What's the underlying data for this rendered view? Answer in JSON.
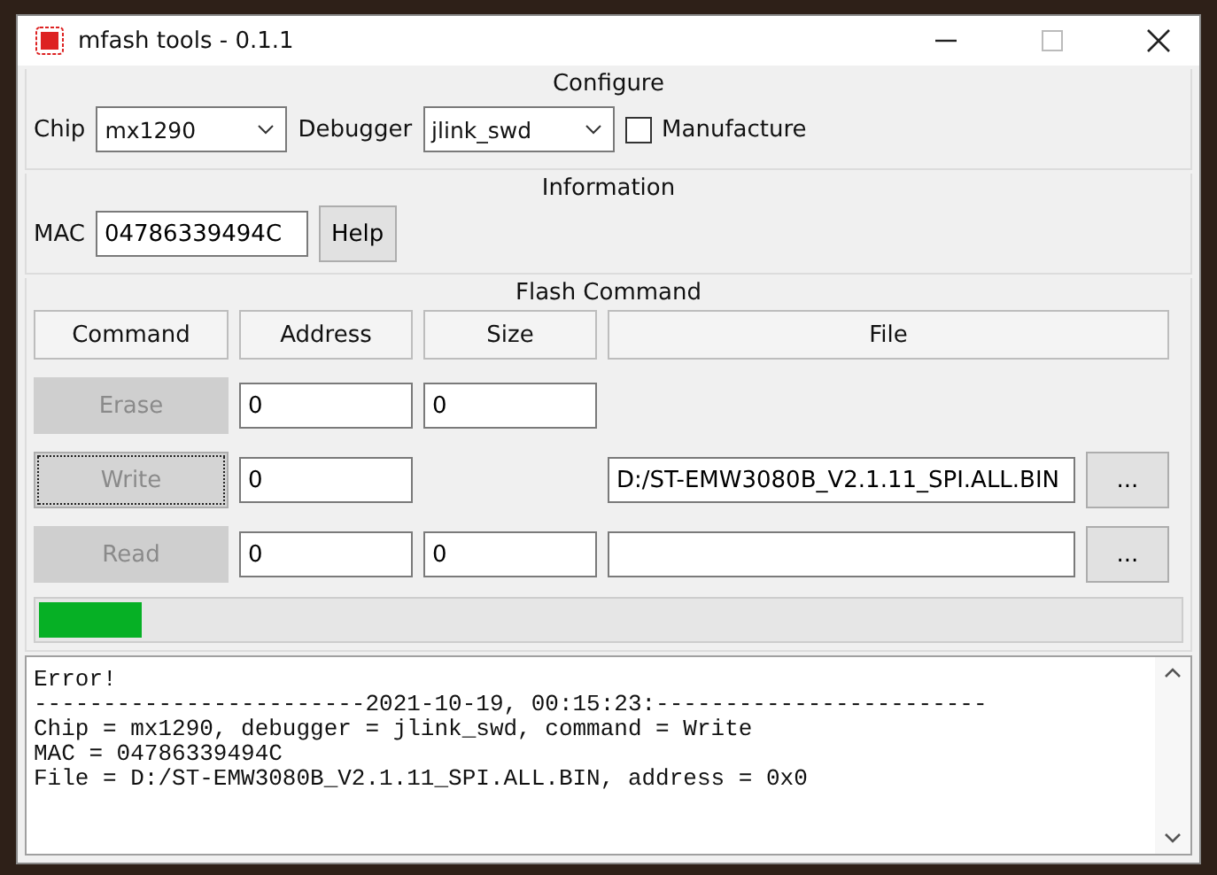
{
  "window": {
    "title": "mfash tools - 0.1.1"
  },
  "configure": {
    "title": "Configure",
    "chip_label": "Chip",
    "chip_value": "mx1290",
    "debugger_label": "Debugger",
    "debugger_value": "jlink_swd",
    "manufacture": {
      "label": "Manufacture",
      "checked": false
    }
  },
  "information": {
    "title": "Information",
    "mac_label": "MAC",
    "mac_value": "04786339494C",
    "help_button": "Help"
  },
  "flash_command": {
    "title": "Flash Command",
    "columns": [
      "Command",
      "Address",
      "Size",
      "File"
    ],
    "rows": [
      {
        "command": "Erase",
        "focused": false,
        "address": "0",
        "size": "0",
        "file": null,
        "browse": null
      },
      {
        "command": "Write",
        "focused": true,
        "address": "0",
        "size": null,
        "file": "D:/ST-EMW3080B_V2.1.11_SPI.ALL.BIN",
        "browse": "..."
      },
      {
        "command": "Read",
        "focused": false,
        "address": "0",
        "size": "0",
        "file": "",
        "browse": "..."
      }
    ],
    "progress": {
      "level": 0.09
    }
  },
  "log": [
    "Error!",
    "------------------------2021-10-19, 00:15:23:------------------------",
    "Chip = mx1290, debugger = jlink_swd, command = Write",
    "MAC = 04786339494C",
    "File = D:/ST-EMW3080B_V2.1.11_SPI.ALL.BIN, address = 0x0"
  ]
}
